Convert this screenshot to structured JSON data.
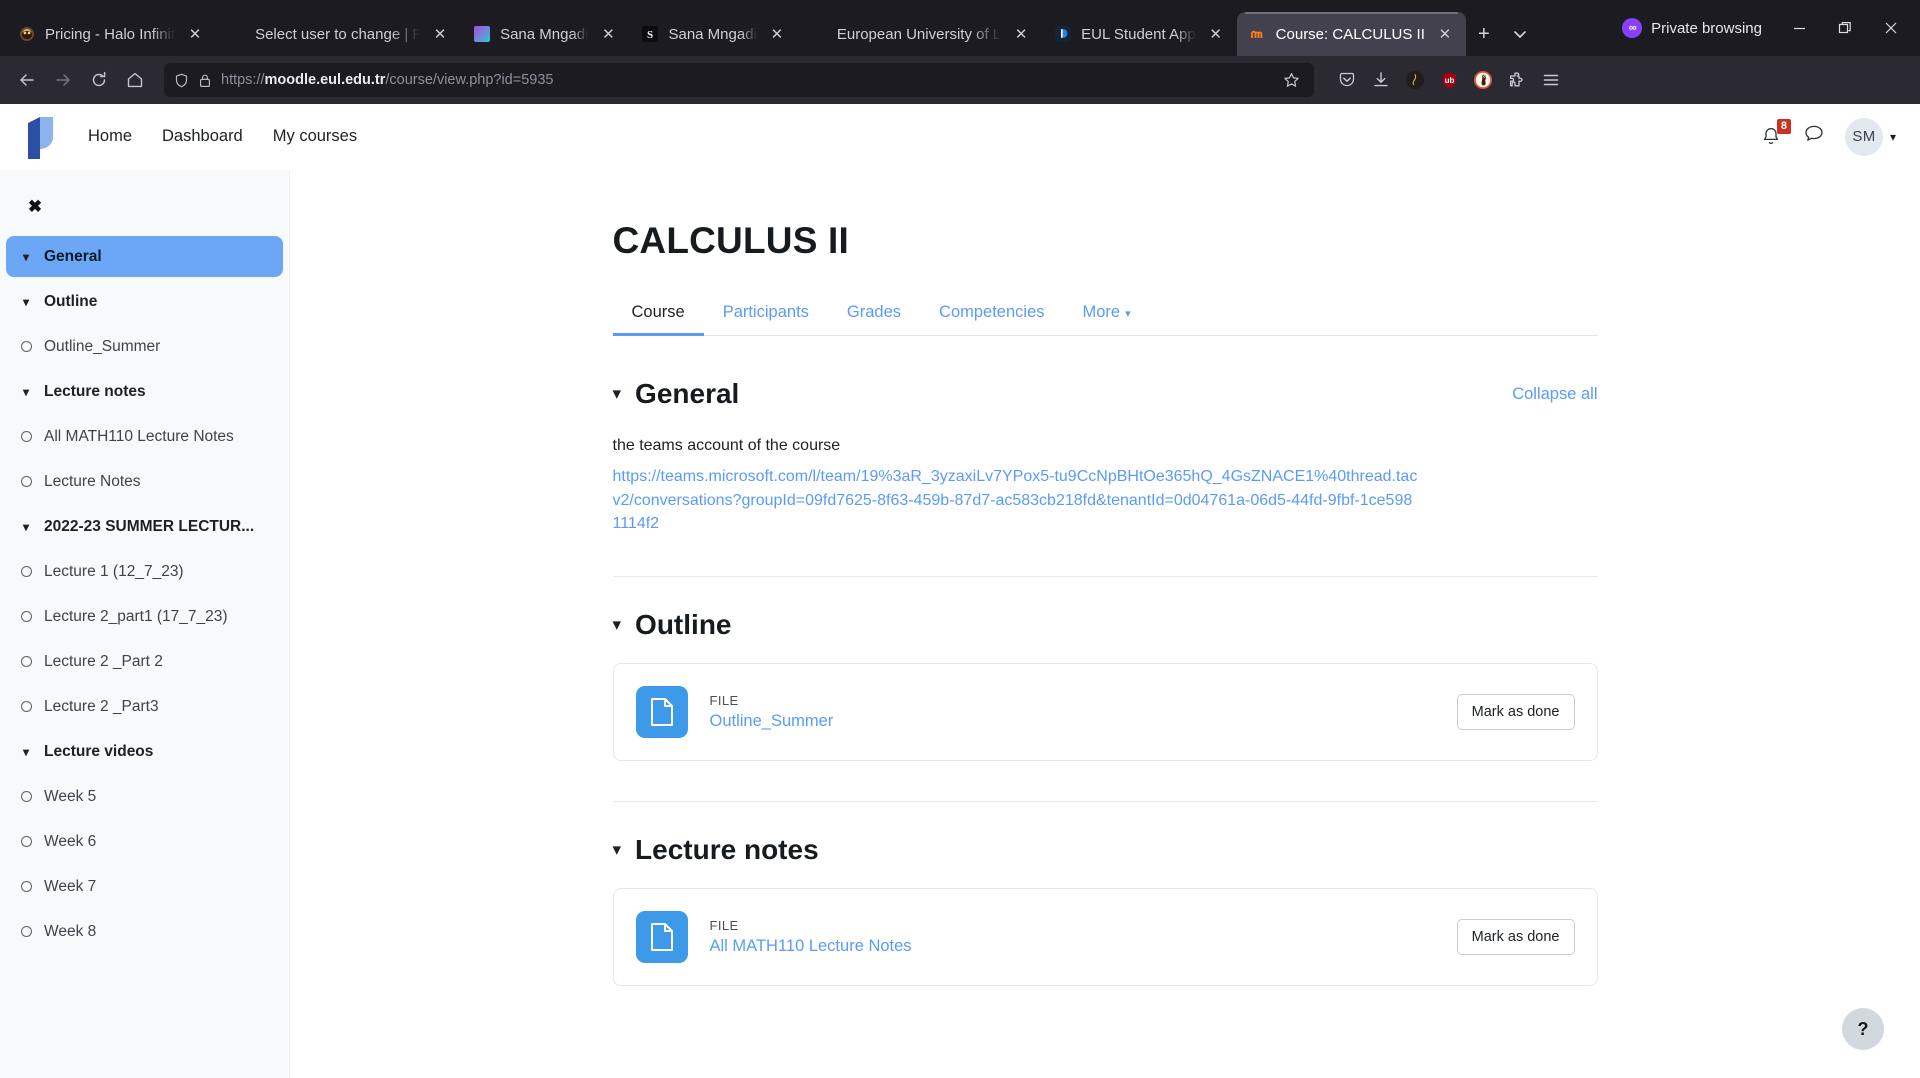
{
  "browser": {
    "tabs": [
      {
        "title": "Pricing - Halo Infinit",
        "favicon": "halo-icon",
        "active": false
      },
      {
        "title": "Select user to change | P",
        "favicon": "none",
        "active": false
      },
      {
        "title": "Sana Mngadi",
        "favicon": "teams-icon",
        "active": false
      },
      {
        "title": "Sana Mngadi",
        "favicon": "skype-icon",
        "active": false
      },
      {
        "title": "European University of L",
        "favicon": "none",
        "active": false
      },
      {
        "title": "EUL Student App",
        "favicon": "app-icon",
        "active": false
      },
      {
        "title": "Course: CALCULUS II",
        "favicon": "moodle-icon",
        "active": true
      }
    ],
    "new_tab_label": "+",
    "list_all_tabs_label": "˅",
    "private_browsing_label": "Private browsing",
    "window_controls": {
      "minimize": "—",
      "restore": "❐",
      "close": "✕"
    },
    "nav": {
      "back": "←",
      "forward": "→",
      "reload": "↻",
      "home": "⌂"
    },
    "url": {
      "scheme": "https://",
      "domain": "moodle.eul.edu.tr",
      "path": "/course/view.php?id=5935",
      "full": "https://moodle.eul.edu.tr/course/view.php?id=5935"
    },
    "extensions": [
      "pocket-icon",
      "download-icon",
      "dark-reader-icon",
      "ublock-origin-icon",
      "duckduckgo-icon",
      "extensions-icon",
      "menu-icon"
    ]
  },
  "header": {
    "logo_label": "moodle-logo",
    "nav": [
      {
        "label": "Home"
      },
      {
        "label": "Dashboard"
      },
      {
        "label": "My courses"
      }
    ],
    "notification_count": "8",
    "avatar_initials": "SM"
  },
  "sidebar": {
    "close_label": "✖",
    "items": [
      {
        "label": "General",
        "type": "section",
        "active": true
      },
      {
        "label": "Outline",
        "type": "section",
        "active": false
      },
      {
        "label": "Outline_Summer",
        "type": "activity",
        "active": false
      },
      {
        "label": "Lecture notes",
        "type": "section",
        "active": false
      },
      {
        "label": "All MATH110 Lecture Notes",
        "type": "activity",
        "active": false
      },
      {
        "label": "Lecture Notes",
        "type": "activity",
        "active": false
      },
      {
        "label": "2022-23 SUMMER LECTUR...",
        "type": "section",
        "active": false
      },
      {
        "label": "Lecture 1 (12_7_23)",
        "type": "activity",
        "active": false
      },
      {
        "label": "Lecture 2_part1 (17_7_23)",
        "type": "activity",
        "active": false
      },
      {
        "label": "Lecture 2 _Part 2",
        "type": "activity",
        "active": false
      },
      {
        "label": "Lecture 2 _Part3",
        "type": "activity",
        "active": false
      },
      {
        "label": "Lecture videos",
        "type": "section",
        "active": false
      },
      {
        "label": "Week 5",
        "type": "activity",
        "active": false
      },
      {
        "label": "Week 6",
        "type": "activity",
        "active": false
      },
      {
        "label": "Week 7",
        "type": "activity",
        "active": false
      },
      {
        "label": "Week 8",
        "type": "activity",
        "active": false
      }
    ]
  },
  "main": {
    "course_title": "CALCULUS II",
    "tabs": [
      {
        "label": "Course",
        "active": true,
        "caret": false
      },
      {
        "label": "Participants",
        "active": false,
        "caret": false
      },
      {
        "label": "Grades",
        "active": false,
        "caret": false
      },
      {
        "label": "Competencies",
        "active": false,
        "caret": false
      },
      {
        "label": "More",
        "active": false,
        "caret": true
      }
    ],
    "collapse_all": "Collapse all",
    "sections": [
      {
        "title": "General",
        "text": "the teams account of the course",
        "link": "https://teams.microsoft.com/l/team/19%3aR_3yzaxiLv7YPox5-tu9CcNpBHtOe365hQ_4GsZNACE1%40thread.tacv2/conversations?groupId=09fd7625-8f63-459b-87d7-ac583cb218fd&tenantId=0d04761a-06d5-44fd-9fbf-1ce5981114f2"
      },
      {
        "title": "Outline",
        "activity": {
          "type": "FILE",
          "name": "Outline_Summer",
          "action": "Mark as done"
        }
      },
      {
        "title": "Lecture notes",
        "activity": {
          "type": "FILE",
          "name": "All MATH110 Lecture Notes",
          "action": "Mark as done"
        }
      }
    ],
    "help_label": "?"
  },
  "colors": {
    "accent_link": "#5b9bf8",
    "sidebar_active": "#6ca7f5",
    "file_icon": "#3c9ae8",
    "badge_red": "#ca3120",
    "chrome_dark": "#1c1b22",
    "navbar_dark": "#2b2a33"
  }
}
